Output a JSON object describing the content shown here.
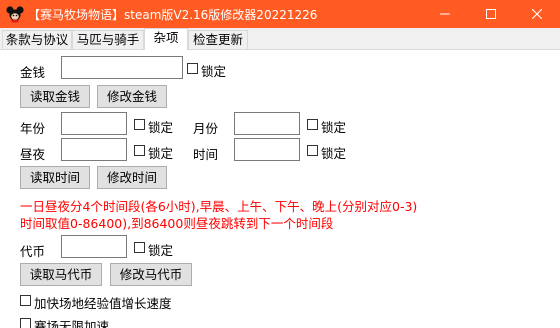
{
  "window": {
    "title": "【赛马牧场物语】steam版V2.16版修改器20221226",
    "controls": [
      "minimize",
      "maximize",
      "close"
    ]
  },
  "tabs": [
    {
      "label": "条款与协议"
    },
    {
      "label": "马匹与骑手"
    },
    {
      "label": "杂项",
      "active": true
    },
    {
      "label": "检查更新"
    }
  ],
  "panel": {
    "money": {
      "label": "金钱",
      "value": "",
      "lock_label": "锁定",
      "read_button": "读取金钱",
      "modify_button": "修改金钱"
    },
    "time": {
      "year_label": "年份",
      "month_label": "月份",
      "daynight_label": "昼夜",
      "time_label": "时间",
      "lock_label": "锁定",
      "read_button": "读取时间",
      "modify_button": "修改时间",
      "note_line1": "一日昼夜分4个时间段(各6小时),早晨、上午、下午、晚上(分别对应0-3)",
      "note_line2": "时间取值0-86400),到86400则昼夜跳转到下一个时间段"
    },
    "tokens": {
      "label": "代币",
      "lock_label": "锁定",
      "read_button": "读取马代币",
      "modify_button": "修改马代币"
    },
    "options": [
      {
        "label": "加快场地经验值增长速度",
        "checked": false
      },
      {
        "label": "赛场无限加速",
        "checked": false
      }
    ]
  },
  "colors": {
    "titlebar": "#ff5b22",
    "note_text": "#ff0000"
  },
  "icons": {
    "app": "mouse-head-icon"
  }
}
